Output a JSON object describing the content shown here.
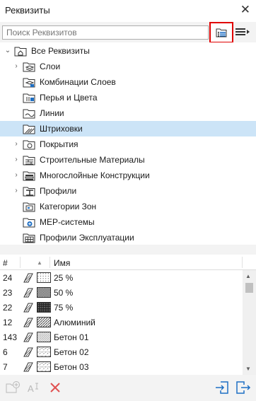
{
  "window": {
    "title": "Реквизиты",
    "close_glyph": "✕"
  },
  "search": {
    "placeholder": "Поиск Реквизитов"
  },
  "tree": {
    "root": "Все Реквизиты",
    "items": [
      {
        "label": "Слои",
        "icon": "layers-folder-icon",
        "expandable": true
      },
      {
        "label": "Комбинации Слоев",
        "icon": "layer-combinations-icon",
        "expandable": false
      },
      {
        "label": "Перья и Цвета",
        "icon": "pens-colors-icon",
        "expandable": false
      },
      {
        "label": "Линии",
        "icon": "line-types-icon",
        "expandable": false
      },
      {
        "label": "Штриховки",
        "icon": "fills-icon",
        "expandable": false,
        "selected": true
      },
      {
        "label": "Покрытия",
        "icon": "surfaces-icon",
        "expandable": true
      },
      {
        "label": "Строительные Материалы",
        "icon": "building-materials-icon",
        "expandable": true
      },
      {
        "label": "Многослойные Конструкции",
        "icon": "composites-icon",
        "expandable": true
      },
      {
        "label": "Профили",
        "icon": "profiles-icon",
        "expandable": true
      },
      {
        "label": "Категории Зон",
        "icon": "zone-categories-icon",
        "expandable": false
      },
      {
        "label": "MEP-системы",
        "icon": "mep-systems-icon",
        "expandable": false
      },
      {
        "label": "Профили Эксплуатации",
        "icon": "operation-profiles-icon",
        "expandable": false
      }
    ]
  },
  "list": {
    "headers": {
      "index": "#",
      "sort": "▲",
      "name": "Имя"
    },
    "rows": [
      {
        "num": "24",
        "name": "25 %",
        "pattern": "dots-sparse"
      },
      {
        "num": "23",
        "name": "50 %",
        "pattern": "dots-medium"
      },
      {
        "num": "22",
        "name": "75 %",
        "pattern": "dots-dense"
      },
      {
        "num": "12",
        "name": "Алюминий",
        "pattern": "diagonal"
      },
      {
        "num": "143",
        "name": "Бетон 01",
        "pattern": "diagonal-thin"
      },
      {
        "num": "6",
        "name": "Бетон 02",
        "pattern": "speckle"
      },
      {
        "num": "7",
        "name": "Бетон 03",
        "pattern": "speckle"
      }
    ]
  },
  "colors": {
    "accent": "#e00000",
    "selection": "#cce4f7",
    "icon_blue": "#1e6fc4",
    "delete_red": "#e05050"
  }
}
